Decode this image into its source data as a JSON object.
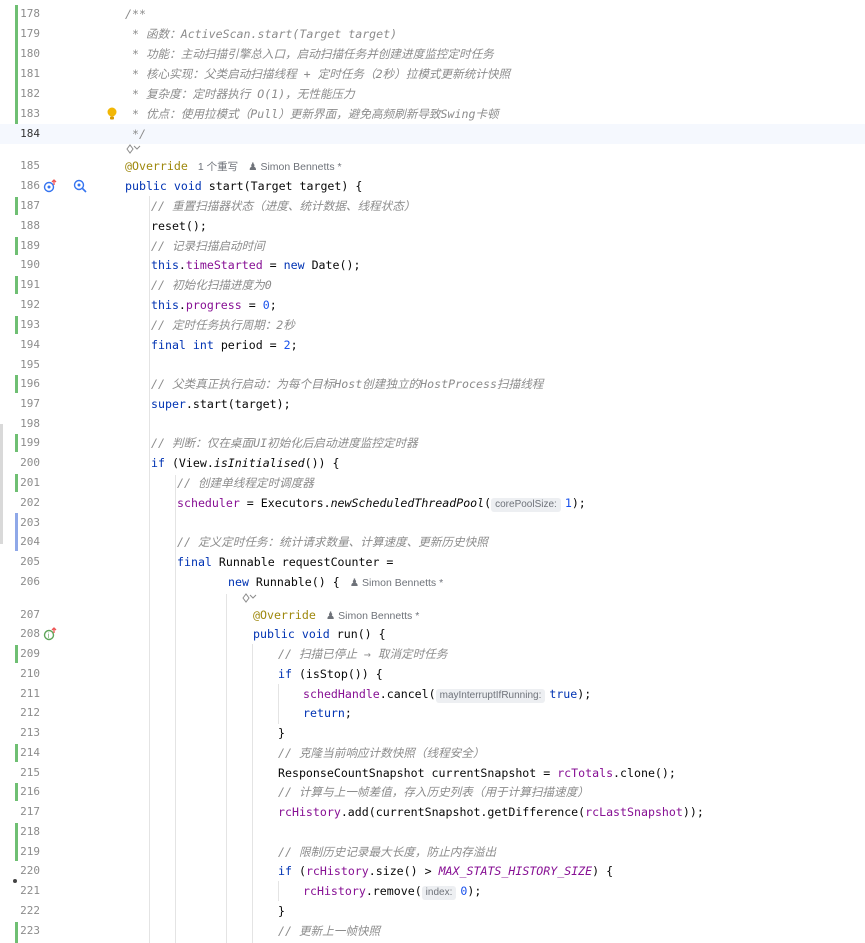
{
  "lines": {
    "l178": {
      "num": "178",
      "code": "/**"
    },
    "l179": {
      "num": "179",
      "code": " * 函数：ActiveScan.start(Target target)"
    },
    "l180": {
      "num": "180",
      "code": " * 功能：主动扫描引擎总入口，启动扫描任务并创建进度监控定时任务"
    },
    "l181": {
      "num": "181",
      "code": " * 核心实现：父类启动扫描线程 + 定时任务（2秒）拉模式更新统计快照"
    },
    "l182": {
      "num": "182",
      "code": " * 复杂度：定时器执行 O(1)，无性能压力"
    },
    "l183": {
      "num": "183",
      "code": " * 优点：使用拉模式（Pull）更新界面，避免高频刷新导致Swing卡顿"
    },
    "l184": {
      "num": "184",
      "code": " */"
    },
    "l185": {
      "num": "185",
      "ann": "@Override",
      "usages": "1 个重写",
      "author": "Simon Bennetts *"
    },
    "l186": {
      "num": "186",
      "kw": "public void ",
      "rest": "start(Target target) {"
    },
    "l187": {
      "num": "187",
      "code": "// 重置扫描器状态（进度、统计数据、线程状态）"
    },
    "l188": {
      "num": "188",
      "code": "reset();"
    },
    "l189": {
      "num": "189",
      "code": "// 记录扫描启动时间"
    },
    "l190": {
      "num": "190",
      "kw": "this",
      "dot": ".",
      "field": "timeStarted",
      "eq": " = ",
      "kw2": "new",
      "rest": " Date();"
    },
    "l191": {
      "num": "191",
      "code": "// 初始化扫描进度为0"
    },
    "l192": {
      "num": "192",
      "kw": "this",
      "dot": ".",
      "field": "progress",
      "eq": " = ",
      "n": "0",
      "semi": ";"
    },
    "l193": {
      "num": "193",
      "code": "// 定时任务执行周期：2秒"
    },
    "l194": {
      "num": "194",
      "kw": "final int ",
      "rest": "period = ",
      "n": "2",
      "semi": ";"
    },
    "l195": {
      "num": "195"
    },
    "l196": {
      "num": "196",
      "code": "// 父类真正执行启动：为每个目标Host创建独立的HostProcess扫描线程"
    },
    "l197": {
      "num": "197",
      "kw": "super",
      "rest": ".start(target);"
    },
    "l198": {
      "num": "198"
    },
    "l199": {
      "num": "199",
      "code": "// 判断：仅在桌面UI初始化后启动进度监控定时器"
    },
    "l200": {
      "num": "200",
      "kw": "if ",
      "pre": "(View.",
      "ital": "isInitialised",
      "rest": "()) {"
    },
    "l201": {
      "num": "201",
      "code": "// 创建单线程定时调度器"
    },
    "l202": {
      "num": "202",
      "field": "scheduler",
      "pre": " = Executors.",
      "ital": "newScheduledThreadPool",
      "open": "(",
      "hint": "corePoolSize:",
      "n": "1",
      "rest": ");"
    },
    "l203": {
      "num": "203"
    },
    "l204": {
      "num": "204",
      "code": "// 定义定时任务：统计请求数量、计算速度、更新历史快照"
    },
    "l205": {
      "num": "205",
      "kw": "final ",
      "rest": "Runnable requestCounter ="
    },
    "l206": {
      "num": "206",
      "kw": "new ",
      "rest": "Runnable() {",
      "author": "Simon Bennetts *"
    },
    "l207": {
      "num": "207",
      "ann": "@Override",
      "author": "Simon Bennetts *"
    },
    "l208": {
      "num": "208",
      "kw": "public void ",
      "rest": "run() {"
    },
    "l209": {
      "num": "209",
      "code": "// 扫描已停止 → 取消定时任务"
    },
    "l210": {
      "num": "210",
      "kw": "if ",
      "rest": "(isStop()) {"
    },
    "l211": {
      "num": "211",
      "field": "schedHandle",
      "pre": ".cancel(",
      "hint": "mayInterruptIfRunning:",
      "kw": "true",
      "rest": ");"
    },
    "l212": {
      "num": "212",
      "kw": "return",
      "rest": ";"
    },
    "l213": {
      "num": "213",
      "code": "}"
    },
    "l214": {
      "num": "214",
      "code": "// 克隆当前响应计数快照（线程安全）"
    },
    "l215": {
      "num": "215",
      "pre": "ResponseCountSnapshot currentSnapshot = ",
      "field": "rcTotals",
      "rest": ".clone();"
    },
    "l216": {
      "num": "216",
      "code": "// 计算与上一帧差值，存入历史列表（用于计算扫描速度）"
    },
    "l217": {
      "num": "217",
      "field": "rcHistory",
      "pre": ".add(currentSnapshot.getDifference(",
      "field2": "rcLastSnapshot",
      "rest": "));"
    },
    "l218": {
      "num": "218"
    },
    "l219": {
      "num": "219",
      "code": "// 限制历史记录最大长度，防止内存溢出"
    },
    "l220": {
      "num": "220",
      "kw": "if ",
      "pre": "(",
      "field": "rcHistory",
      "mid": ".size() > ",
      "cst": "MAX_STATS_HISTORY_SIZE",
      "rest": ") {"
    },
    "l221": {
      "num": "221",
      "field": "rcHistory",
      "pre": ".remove(",
      "hint": "index:",
      "n": "0",
      "rest": ");"
    },
    "l222": {
      "num": "222",
      "code": "}"
    },
    "l223": {
      "num": "223",
      "code": "// 更新上一帧快照"
    }
  },
  "colors": {
    "added": "#6fbf73",
    "modified": "#8fa8e8",
    "keyword": "#0033b3",
    "field": "#871094",
    "number": "#1750eb",
    "annotation": "#9e880d",
    "comment": "#8c8c8c"
  },
  "icons": [
    "lightbulb-icon",
    "override-up-icon",
    "find-usages-icon",
    "implement-icon",
    "ai-assist-icon"
  ]
}
